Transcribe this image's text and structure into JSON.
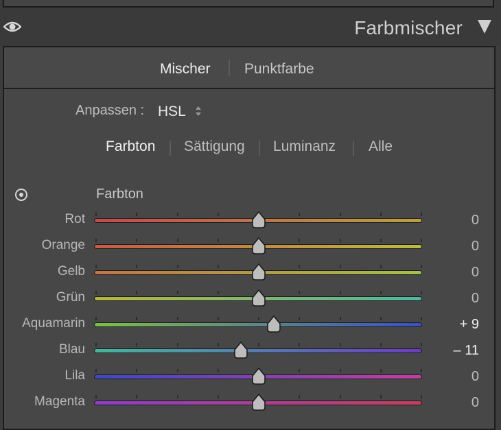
{
  "panel": {
    "title": "Farbmischer"
  },
  "mode_tabs": [
    {
      "label": "Mischer",
      "active": true
    },
    {
      "label": "Punktfarbe",
      "active": false
    }
  ],
  "adjust": {
    "label": "Anpassen :",
    "value": "HSL"
  },
  "property_tabs": [
    {
      "label": "Farbton",
      "active": true
    },
    {
      "label": "Sättigung",
      "active": false
    },
    {
      "label": "Luminanz",
      "active": false
    },
    {
      "label": "Alle",
      "active": false
    }
  ],
  "section": {
    "label": "Farbton"
  },
  "slider_range": [
    -100,
    100
  ],
  "sliders": [
    {
      "label": "Rot",
      "display": "0",
      "value": 0,
      "colors": [
        "#c24a4e",
        "#b9a043"
      ]
    },
    {
      "label": "Orange",
      "display": "0",
      "value": 0,
      "colors": [
        "#c65a48",
        "#bcbc42"
      ]
    },
    {
      "label": "Gelb",
      "display": "0",
      "value": 0,
      "colors": [
        "#c07548",
        "#a3c04b"
      ]
    },
    {
      "label": "Grün",
      "display": "0",
      "value": 0,
      "colors": [
        "#b7b640",
        "#4db8a0"
      ]
    },
    {
      "label": "Aquamarin",
      "display": "+ 9",
      "value": 9,
      "colors": [
        "#7cbf4a",
        "#3b50c2"
      ]
    },
    {
      "label": "Blau",
      "display": "– 11",
      "value": -11,
      "colors": [
        "#45b79a",
        "#6b3cc2"
      ]
    },
    {
      "label": "Lila",
      "display": "0",
      "value": 0,
      "colors": [
        "#3f48c0",
        "#c23fa0"
      ]
    },
    {
      "label": "Magenta",
      "display": "0",
      "value": 0,
      "colors": [
        "#8c3fc6",
        "#c23f5e"
      ]
    }
  ],
  "icons": {
    "visibility": "eye-icon",
    "collapse": "triangle-down-icon",
    "target": "target-adjust-icon",
    "stepper": "up-down-arrows-icon",
    "thumb": "slider-thumb-icon"
  }
}
